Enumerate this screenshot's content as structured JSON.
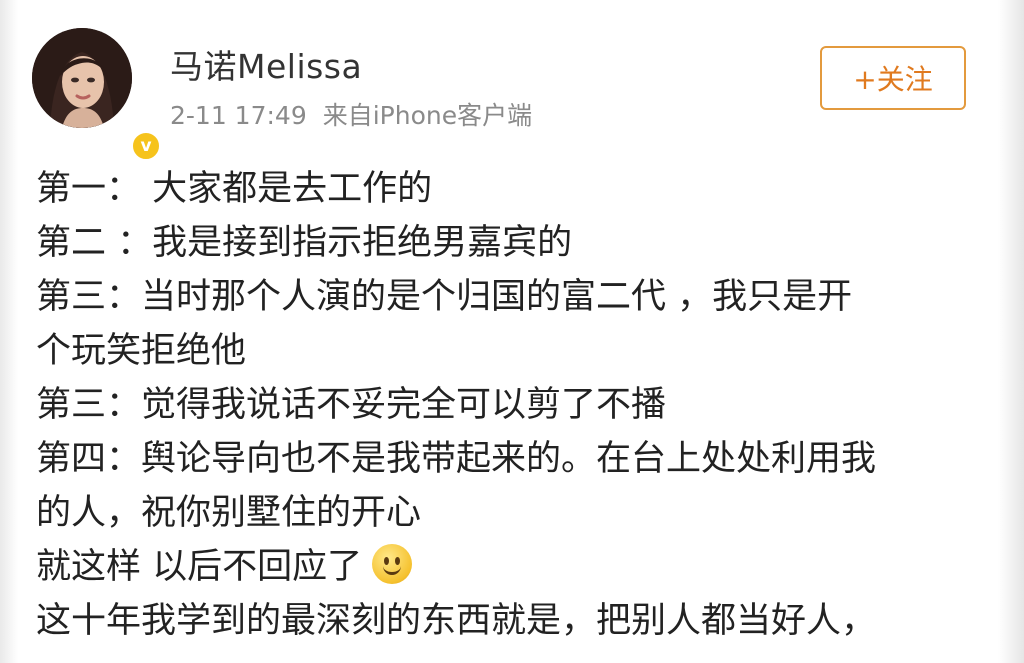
{
  "post": {
    "user": {
      "name": "马诺Melissa",
      "verified_badge": "v"
    },
    "timestamp": "2-11 17:49",
    "source": "来自iPhone客户端",
    "follow_label": "+关注",
    "lines": [
      "第一：  大家都是去工作的",
      "第二 ：我是接到指示拒绝男嘉宾的",
      "第三：当时那个人演的是个归国的富二代 ，我只是开",
      "个玩笑拒绝他",
      "第三：觉得我说话不妥完全可以剪了不播",
      "第四：舆论导向也不是我带起来的。在台上处处利用我",
      "的人，祝你别墅住的开心",
      "就这样 以后不回应了",
      "这十年我学到的最深刻的东西就是，把别人都当好人，"
    ],
    "emoji": "smile-emoji"
  },
  "colors": {
    "follow_accent": "#e39a3d",
    "meta_text": "#8a8a8a",
    "verified": "#f6c31c"
  }
}
